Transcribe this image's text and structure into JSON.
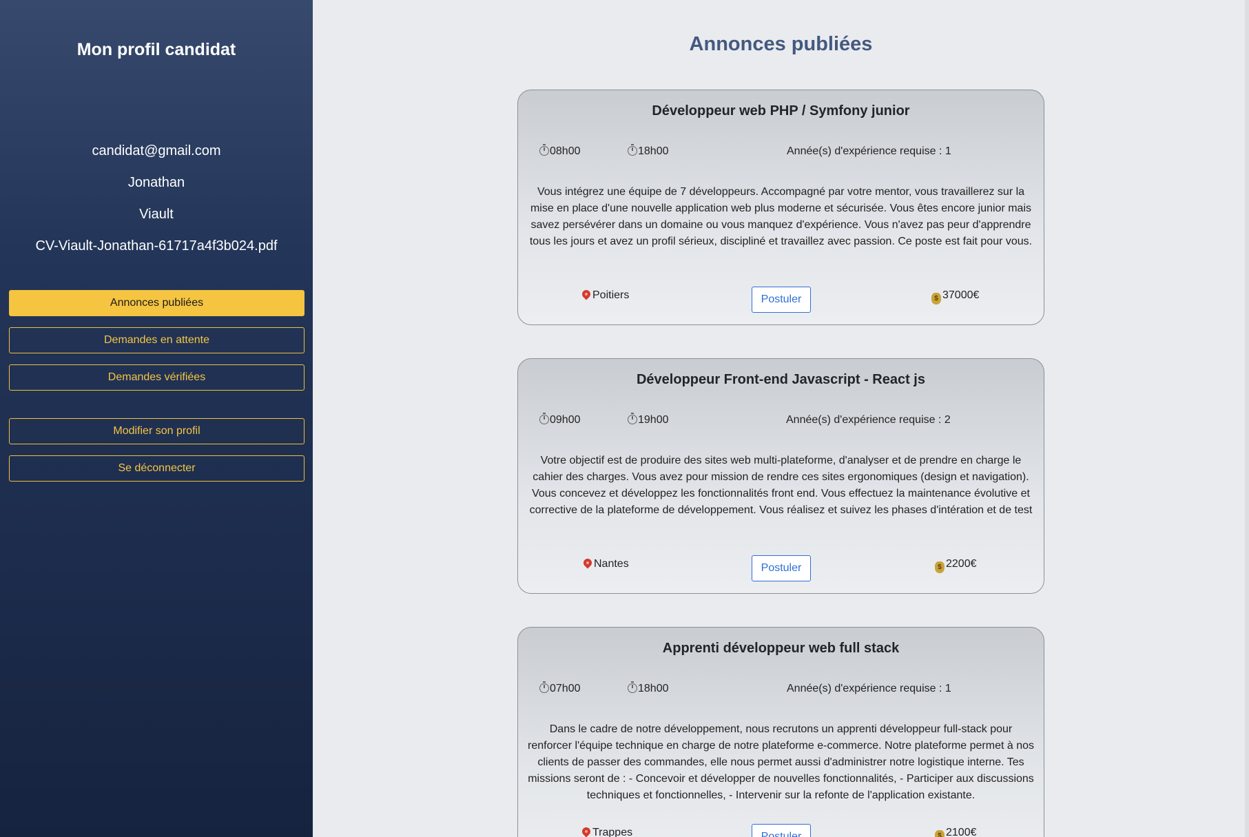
{
  "sidebar": {
    "title": "Mon profil candidat",
    "email": "candidat@gmail.com",
    "first_name": "Jonathan",
    "last_name": "Viault",
    "cv_file": "CV-Viault-Jonathan-61717a4f3b024.pdf",
    "nav": [
      {
        "label": "Annonces publiées",
        "active": true
      },
      {
        "label": "Demandes en attente",
        "active": false
      },
      {
        "label": "Demandes vérifiées",
        "active": false
      },
      {
        "label": "Modifier son profil",
        "active": false
      },
      {
        "label": "Se déconnecter",
        "active": false
      }
    ]
  },
  "main": {
    "title": "Annonces publiées",
    "apply_label": "Postuler",
    "offers": [
      {
        "title": "Développeur web PHP / Symfony junior",
        "start": "08h00",
        "end": "18h00",
        "experience": "Année(s) d'expérience requise : 1",
        "description": "Vous intégrez une équipe de 7 développeurs. Accompagné par votre mentor, vous travaillerez sur la mise en place d'une nouvelle application web plus moderne et sécurisée. Vous êtes encore junior mais savez persévérer dans un domaine ou vous manquez d'expérience. Vous n'avez pas peur d'apprendre tous les jours et avez un profil sérieux, discipliné et travaillez avec passion. Ce poste est fait pour vous.",
        "city": "Poitiers",
        "salary": "37000€"
      },
      {
        "title": "Développeur Front-end Javascript - React js",
        "start": "09h00",
        "end": "19h00",
        "experience": "Année(s) d'expérience requise : 2",
        "description": "Votre objectif est de produire des sites web multi-plateforme, d'analyser et de prendre en charge le cahier des charges. Vous avez pour mission de rendre ces sites ergonomiques (design et navigation). Vous concevez et développez les fonctionnalités front end. Vous effectuez la maintenance évolutive et corrective de la plateforme de développement. Vous réalisez et suivez les phases d'intération et de test",
        "city": "Nantes",
        "salary": "2200€"
      },
      {
        "title": "Apprenti développeur web full stack",
        "start": "07h00",
        "end": "18h00",
        "experience": "Année(s) d'expérience requise : 1",
        "description": "Dans le cadre de notre développement, nous recrutons un apprenti développeur full-stack pour renforcer l'équipe technique en charge de notre plateforme e-commerce. Notre plateforme permet à nos clients de passer des commandes, elle nous permet aussi d'administrer notre logistique interne. Tes missions seront de : - Concevoir et développer de nouvelles fonctionnalités, - Participer aux discussions techniques et fonctionnelles, - Intervenir sur la refonte de l'application existante.",
        "city": "Trappes",
        "salary": "2100€"
      }
    ]
  }
}
